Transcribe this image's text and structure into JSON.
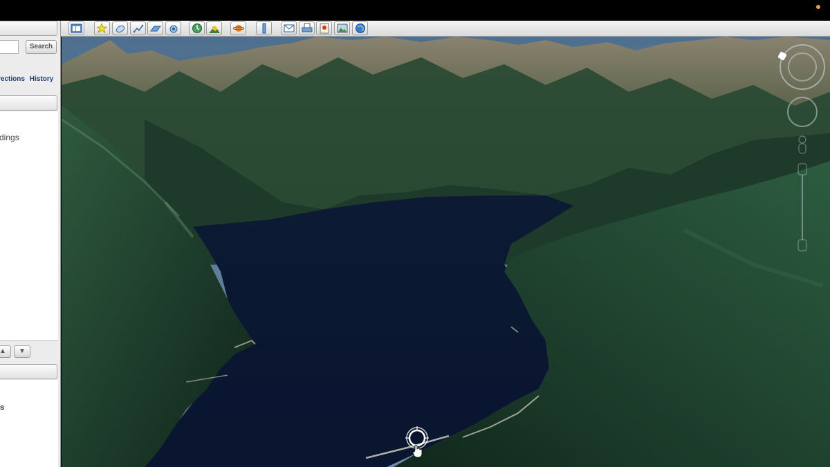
{
  "sidebar": {
    "search_button": "Search",
    "search_value": "",
    "links": {
      "directions": "rections",
      "history": "History"
    },
    "panel_text": "dings",
    "lower_text": "s",
    "up_arrow": "▲",
    "down_arrow": "▼"
  },
  "toolbar": {
    "buttons": [
      {
        "name": "hide-sidebar-icon"
      },
      {
        "name": "add-placemark-icon"
      },
      {
        "name": "add-polygon-icon"
      },
      {
        "name": "add-path-icon"
      },
      {
        "name": "add-image-overlay-icon"
      },
      {
        "name": "record-tour-icon"
      },
      {
        "name": "historical-imagery-icon"
      },
      {
        "name": "sunlight-icon"
      },
      {
        "name": "switch-sky-icon"
      },
      {
        "name": "ruler-icon"
      },
      {
        "name": "email-icon"
      },
      {
        "name": "print-icon"
      },
      {
        "name": "save-image-icon"
      },
      {
        "name": "view-in-maps-icon"
      },
      {
        "name": "globe-icon"
      }
    ]
  },
  "colors": {
    "water": "#0d1a33",
    "forest_dark": "#1d3a2b",
    "forest_light": "#2e5a3c",
    "rock": "#7a7060",
    "sky": "#4f6f8f"
  }
}
